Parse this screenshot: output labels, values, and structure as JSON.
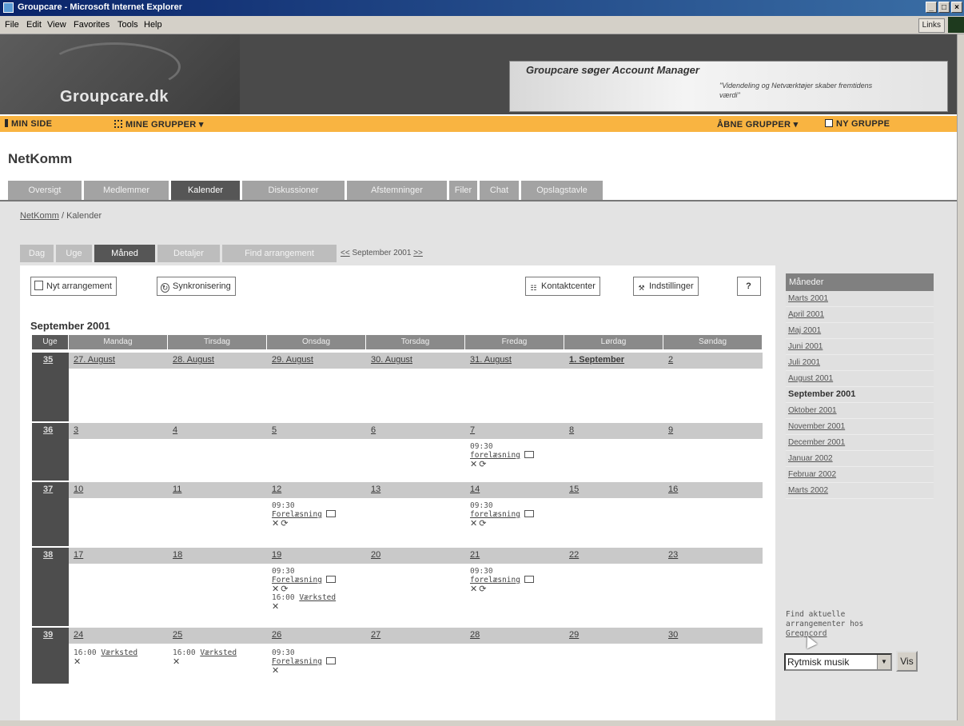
{
  "window": {
    "title": "Groupcare - Microsoft Internet Explorer"
  },
  "menu": [
    "File",
    "Edit",
    "View",
    "Favorites",
    "Tools",
    "Help"
  ],
  "links_label": "Links",
  "banner": {
    "logo": "Groupcare.dk",
    "ad_headline": "Groupcare søger Account Manager",
    "ad_tagline": "\"Videndeling og Netværktøjer skaber fremtidens værdi\""
  },
  "topnav": {
    "my_page": "MIN SIDE",
    "my_groups": "MINE GRUPPER ▾",
    "open_groups": "ÅBNE GRUPPER ▾",
    "new_group": "NY GRUPPE"
  },
  "group_name": "NetKomm",
  "tabs": [
    "Oversigt",
    "Medlemmer",
    "Kalender",
    "Diskussioner",
    "Afstemninger",
    "Filer",
    "Chat",
    "Opslagstavle"
  ],
  "breadcrumb": {
    "root": "NetKomm",
    "sep": " / ",
    "current": "Kalender"
  },
  "subtabs": [
    "Dag",
    "Uge",
    "Måned",
    "Detaljer",
    "Find arrangement"
  ],
  "monthnav": {
    "prev": "<<",
    "label": "September 2001",
    "next": ">>"
  },
  "toolbar": {
    "new_event": "Nyt arrangement",
    "sync": "Synkronisering",
    "contacts": "Kontaktcenter",
    "settings": "Indstillinger",
    "help": "?"
  },
  "calendar": {
    "title": "September 2001",
    "headers": [
      "Uge",
      "Mandag",
      "Tirsdag",
      "Onsdag",
      "Torsdag",
      "Fredag",
      "Lørdag",
      "Søndag"
    ],
    "weeks": [
      {
        "week": "35",
        "days": [
          "27. August",
          "28. August",
          "29. August",
          "30. August",
          "31. August",
          "1. September",
          "2"
        ]
      },
      {
        "week": "36",
        "days": [
          "3",
          "4",
          "5",
          "6",
          "7",
          "8",
          "9"
        ]
      },
      {
        "week": "37",
        "days": [
          "10",
          "11",
          "12",
          "13",
          "14",
          "15",
          "16"
        ]
      },
      {
        "week": "38",
        "days": [
          "17",
          "18",
          "19",
          "20",
          "21",
          "22",
          "23"
        ]
      },
      {
        "week": "39",
        "days": [
          "24",
          "25",
          "26",
          "27",
          "28",
          "29",
          "30"
        ]
      }
    ],
    "events": {
      "w36_fri_time": "09:30",
      "w36_fri_title": "forelæsning",
      "w37_wed_time": "09:30",
      "w37_wed_title": "Forelæsning",
      "w37_fri_time": "09:30",
      "w37_fri_title": "forelæsning",
      "w38_wed_time": "09:30",
      "w38_wed_title": "Forelæsning",
      "w38_wed_time2": "16:00",
      "w38_wed_title2": "Værksted",
      "w38_fri_time": "09:30",
      "w38_fri_title": "forelæsning",
      "w39_mon_time": "16:00",
      "w39_mon_title": "Værksted",
      "w39_tue_time": "16:00",
      "w39_tue_title": "Værksted",
      "w39_wed_time": "09:30",
      "w39_wed_title": "Forelæsning"
    }
  },
  "sidebar": {
    "head": "Måneder",
    "months": [
      "Marts 2001",
      "April 2001",
      "Maj 2001",
      "Juni 2001",
      "Juli 2001",
      "August 2001",
      "September 2001",
      "Oktober 2001",
      "November 2001",
      "December 2001",
      "Januar 2002",
      "Februar 2002",
      "Marts 2002"
    ],
    "find_text": "Find aktuelle arrangementer hos",
    "find_link": "Gregncord",
    "select_value": "Rytmisk musik",
    "vis": "Vis"
  },
  "colors": {
    "nav_orange": "#f9b441",
    "tab_gray": "#a3a3a3",
    "tab_active": "#565656"
  }
}
